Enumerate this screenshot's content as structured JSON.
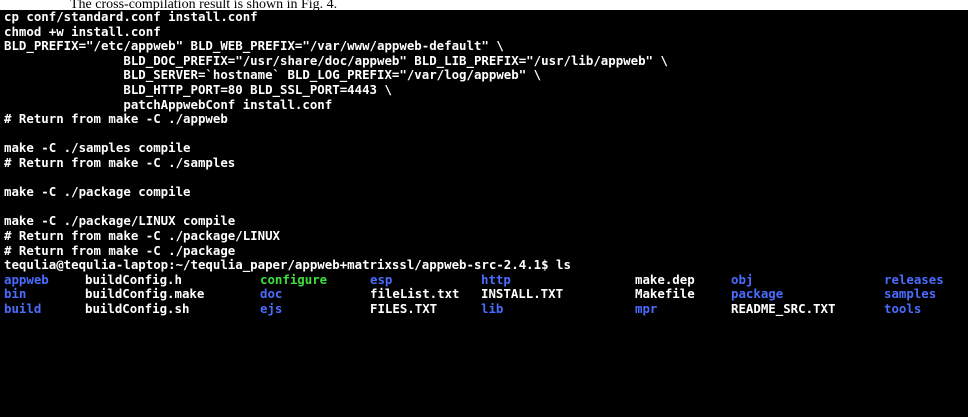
{
  "caption": "The cross-compilation result is shown in Fig. 4.",
  "terminal": {
    "lines": [
      "cp conf/standard.conf install.conf",
      "chmod +w install.conf",
      "BLD_PREFIX=\"/etc/appweb\" BLD_WEB_PREFIX=\"/var/www/appweb-default\" \\",
      "                BLD_DOC_PREFIX=\"/usr/share/doc/appweb\" BLD_LIB_PREFIX=\"/usr/lib/appweb\" \\",
      "                BLD_SERVER=`hostname` BLD_LOG_PREFIX=\"/var/log/appweb\" \\",
      "                BLD_HTTP_PORT=80 BLD_SSL_PORT=4443 \\",
      "                patchAppwebConf install.conf",
      "# Return from make -C ./appweb",
      "",
      "make -C ./samples compile",
      "# Return from make -C ./samples",
      "",
      "make -C ./package compile",
      "",
      "make -C ./package/LINUX compile",
      "# Return from make -C ./package/LINUX",
      "# Return from make -C ./package",
      "tequlia@tequlia-laptop:~/tequlia_paper/appweb+matrixssl/appweb-src-2.4.1$ ls"
    ],
    "ls_rows": [
      [
        "appweb",
        "buildConfig.h",
        "configure",
        "esp",
        "http",
        "make.dep",
        "obj",
        "releases"
      ],
      [
        "bin",
        "buildConfig.make",
        "doc",
        "fileList.txt",
        "INSTALL.TXT",
        "Makefile",
        "package",
        "samples"
      ],
      [
        "build",
        "buildConfig.sh",
        "ejs",
        "FILES.TXT",
        "lib",
        "mpr",
        "README_SRC.TXT",
        "tools"
      ]
    ]
  },
  "colors": {
    "background": "#000000",
    "text": "#ffffff",
    "directory": "#4a6cff",
    "executable": "#3ce03c"
  }
}
